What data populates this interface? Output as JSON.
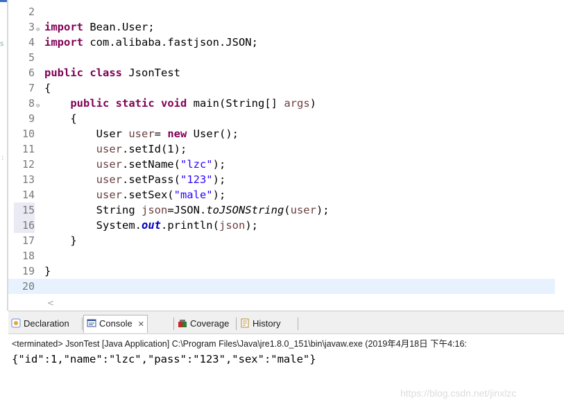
{
  "editor": {
    "lines": [
      {
        "n": "2",
        "code": [],
        "marked": false,
        "current": false,
        "fold": false
      },
      {
        "n": "3",
        "fold": true,
        "code": [
          {
            "t": "import",
            "c": "kw"
          },
          {
            "t": " Bean.User;",
            "c": ""
          }
        ]
      },
      {
        "n": "4",
        "code": [
          {
            "t": "import",
            "c": "kw"
          },
          {
            "t": " com.alibaba.fastjson.JSON;",
            "c": ""
          }
        ]
      },
      {
        "n": "5",
        "code": []
      },
      {
        "n": "6",
        "code": [
          {
            "t": "public",
            "c": "kw"
          },
          {
            "t": " ",
            "c": ""
          },
          {
            "t": "class",
            "c": "kw"
          },
          {
            "t": " JsonTest",
            "c": ""
          }
        ]
      },
      {
        "n": "7",
        "code": [
          {
            "t": "{",
            "c": ""
          }
        ]
      },
      {
        "n": "8",
        "fold": true,
        "code": [
          {
            "t": "    ",
            "c": ""
          },
          {
            "t": "public",
            "c": "kw"
          },
          {
            "t": " ",
            "c": ""
          },
          {
            "t": "static",
            "c": "kw"
          },
          {
            "t": " ",
            "c": ""
          },
          {
            "t": "void",
            "c": "kw"
          },
          {
            "t": " main(String[] ",
            "c": ""
          },
          {
            "t": "args",
            "c": "var"
          },
          {
            "t": ")",
            "c": ""
          }
        ]
      },
      {
        "n": "9",
        "code": [
          {
            "t": "    {",
            "c": ""
          }
        ]
      },
      {
        "n": "10",
        "code": [
          {
            "t": "        User ",
            "c": ""
          },
          {
            "t": "user",
            "c": "var"
          },
          {
            "t": "= ",
            "c": ""
          },
          {
            "t": "new",
            "c": "kw"
          },
          {
            "t": " User();",
            "c": ""
          }
        ]
      },
      {
        "n": "11",
        "code": [
          {
            "t": "        ",
            "c": ""
          },
          {
            "t": "user",
            "c": "var"
          },
          {
            "t": ".setId(1);",
            "c": ""
          }
        ]
      },
      {
        "n": "12",
        "code": [
          {
            "t": "        ",
            "c": ""
          },
          {
            "t": "user",
            "c": "var"
          },
          {
            "t": ".setName(",
            "c": ""
          },
          {
            "t": "\"lzc\"",
            "c": "str"
          },
          {
            "t": ");",
            "c": ""
          }
        ]
      },
      {
        "n": "13",
        "code": [
          {
            "t": "        ",
            "c": ""
          },
          {
            "t": "user",
            "c": "var"
          },
          {
            "t": ".setPass(",
            "c": ""
          },
          {
            "t": "\"123\"",
            "c": "str"
          },
          {
            "t": ");",
            "c": ""
          }
        ]
      },
      {
        "n": "14",
        "code": [
          {
            "t": "        ",
            "c": ""
          },
          {
            "t": "user",
            "c": "var"
          },
          {
            "t": ".setSex(",
            "c": ""
          },
          {
            "t": "\"male\"",
            "c": "str"
          },
          {
            "t": ");",
            "c": ""
          }
        ]
      },
      {
        "n": "15",
        "marked": true,
        "code": [
          {
            "t": "        String ",
            "c": ""
          },
          {
            "t": "json",
            "c": "var"
          },
          {
            "t": "=JSON.",
            "c": ""
          },
          {
            "t": "toJSONString",
            "c": "ital"
          },
          {
            "t": "(",
            "c": ""
          },
          {
            "t": "user",
            "c": "var"
          },
          {
            "t": ");",
            "c": ""
          }
        ]
      },
      {
        "n": "16",
        "marked": true,
        "code": [
          {
            "t": "        System.",
            "c": ""
          },
          {
            "t": "out",
            "c": "field"
          },
          {
            "t": ".println(",
            "c": ""
          },
          {
            "t": "json",
            "c": "var"
          },
          {
            "t": ");",
            "c": ""
          }
        ]
      },
      {
        "n": "17",
        "code": [
          {
            "t": "    }",
            "c": ""
          }
        ]
      },
      {
        "n": "18",
        "code": []
      },
      {
        "n": "19",
        "code": [
          {
            "t": "}",
            "c": ""
          }
        ]
      },
      {
        "n": "20",
        "current": true,
        "code": []
      }
    ],
    "scroll_left_arrow": "<"
  },
  "panel": {
    "tabs": [
      {
        "label": "Declaration",
        "icon": "declaration-icon",
        "active": false,
        "closable": false
      },
      {
        "label": "Console",
        "icon": "console-icon",
        "active": true,
        "closable": true,
        "close_glyph": "✕"
      },
      {
        "label": "Coverage",
        "icon": "coverage-icon",
        "active": false,
        "closable": false
      },
      {
        "label": "History",
        "icon": "history-icon",
        "active": false,
        "closable": false
      }
    ],
    "status": "<terminated> JsonTest [Java Application] C:\\Program Files\\Java\\jre1.8.0_151\\bin\\javaw.exe (2019年4月18日 下午4:16:",
    "output": "{\"id\":1,\"name\":\"lzc\",\"pass\":\"123\",\"sex\":\"male\"}",
    "watermark": "https://blog.csdn.net/jinxlzc"
  },
  "colors": {
    "keyword": "#7f0055",
    "local_var": "#6a3e3e",
    "string": "#2a00ff",
    "static_field": "#0000c0",
    "current_line": "#e8f2fe"
  }
}
